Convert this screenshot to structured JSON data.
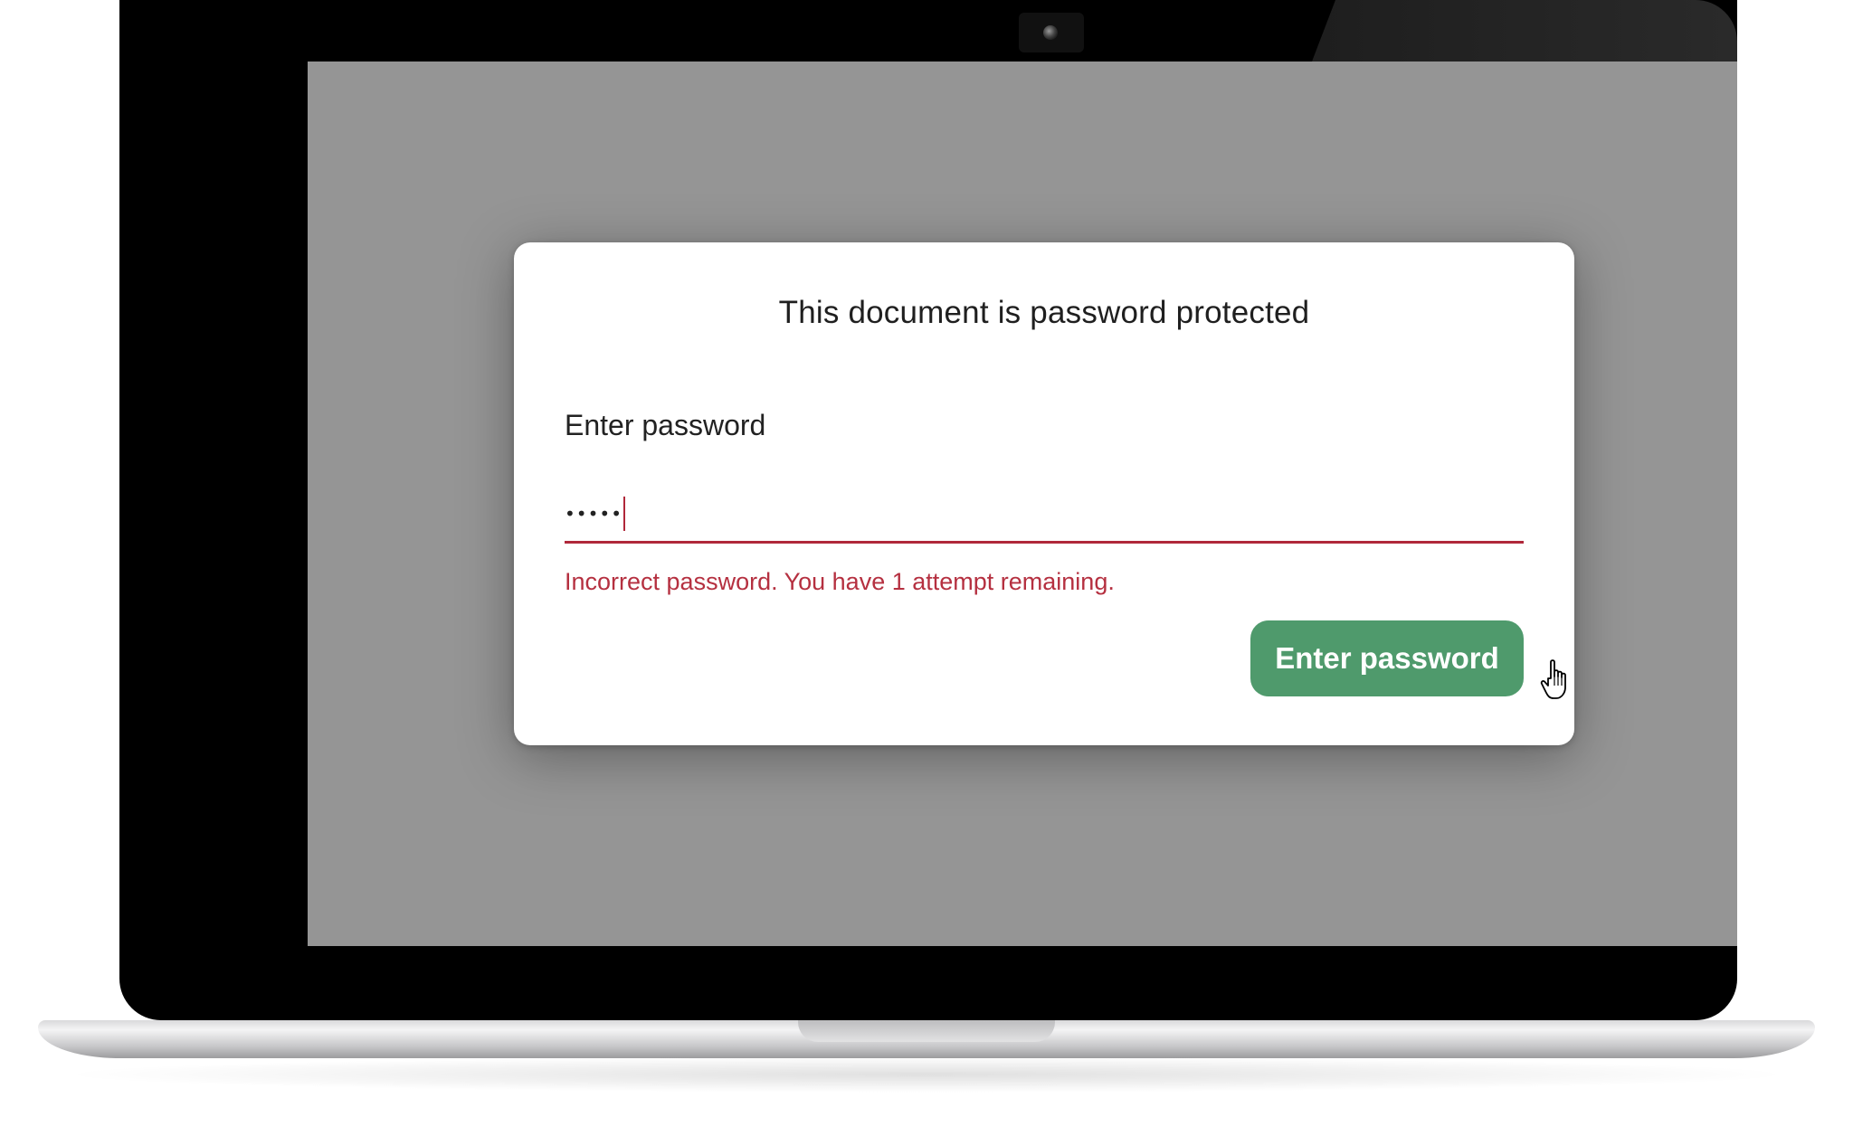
{
  "dialog": {
    "title": "This document is password protected",
    "field_label": "Enter password",
    "password_value": "•••••",
    "error_message": "Incorrect password. You have 1 attempt remaining.",
    "submit_label": "Enter password"
  },
  "colors": {
    "screen_overlay": "#959595",
    "error": "#b53040",
    "button": "#4f9a6c",
    "bezel": "#000000"
  },
  "icons": {
    "camera": "webcam-icon",
    "pointer": "hand-pointer-cursor-icon"
  }
}
